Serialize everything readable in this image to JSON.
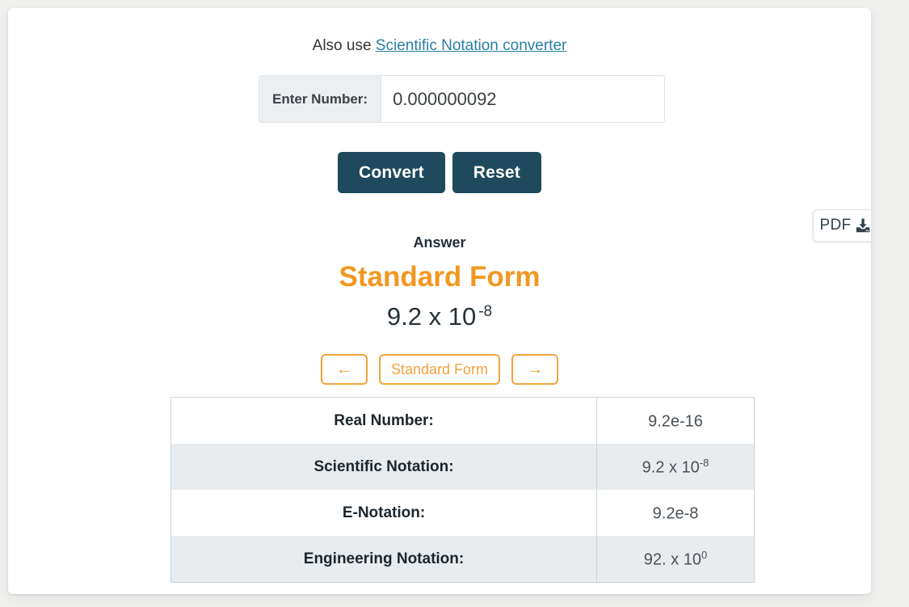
{
  "alsouse": {
    "prefix": "Also use ",
    "link_text": "Scientific Notation converter",
    "link_color": "#2a7fa5"
  },
  "input": {
    "addon_label": "Enter Number:",
    "value": "0.000000092",
    "placeholder": "Enter Number"
  },
  "actions": {
    "convert_label": "Convert",
    "reset_label": "Reset",
    "button_color": "#1f4a5e"
  },
  "pdf": {
    "label": "PDF",
    "icon": "download-icon"
  },
  "answer": {
    "title": "Answer",
    "heading": "Standard Form",
    "heading_color": "#f2971f",
    "mantissa": "9.2 x 10",
    "exponent": "-8"
  },
  "pager": {
    "prev_icon": "←",
    "label": "Standard Form",
    "next_icon": "→",
    "accent_color": "#f2a33c"
  },
  "results": {
    "rows": [
      {
        "label": "Real Number:",
        "value": "9.2e-16",
        "sup": ""
      },
      {
        "label": "Scientific Notation:",
        "value": "9.2 x 10",
        "sup": "-8"
      },
      {
        "label": "E-Notation:",
        "value": "9.2e-8",
        "sup": ""
      },
      {
        "label": "Engineering Notation:",
        "value": "92. x 10",
        "sup": "0"
      }
    ]
  }
}
